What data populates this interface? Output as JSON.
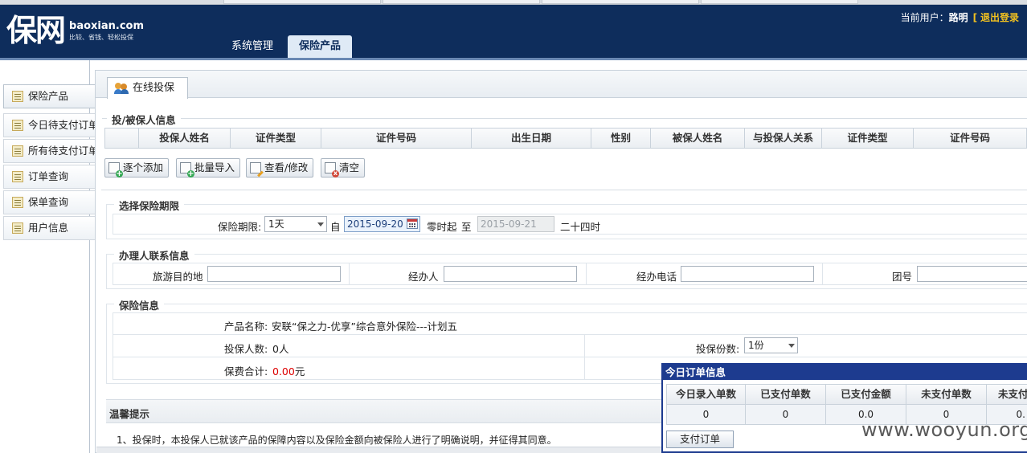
{
  "brand": {
    "mark": "保网",
    "domain": "baoxian.com",
    "slogan": "比较、省钱、轻松投保"
  },
  "userbar": {
    "label": "当前用户：",
    "username": "路明",
    "bracket": "[",
    "logout": "退出登录"
  },
  "nav": {
    "tabs": [
      {
        "label": "系统管理"
      },
      {
        "label": "保险产品"
      }
    ],
    "active": "保险产品"
  },
  "sidebar": {
    "items": [
      {
        "label": "保险产品",
        "icon": "document-icon"
      },
      {
        "label": "今日待支付订单",
        "icon": "document-icon"
      },
      {
        "label": "所有待支付订单",
        "icon": "document-icon"
      },
      {
        "label": "订单查询",
        "icon": "document-icon"
      },
      {
        "label": "保单查询",
        "icon": "document-icon"
      },
      {
        "label": "用户信息",
        "icon": "document-icon"
      }
    ]
  },
  "main": {
    "tab_label": "在线投保",
    "insured_section": {
      "legend": "投/被保人信息",
      "columns": [
        "投保人姓名",
        "证件类型",
        "证件号码",
        "出生日期",
        "性别",
        "被保人姓名",
        "与投保人关系",
        "证件类型",
        "证件号码"
      ],
      "buttons": [
        "逐个添加",
        "批量导入",
        "查看/修改",
        "清空"
      ]
    },
    "period_section": {
      "legend": "选择保险期限",
      "period_label": "保险期限:",
      "period_value": "1天",
      "from_label": "自",
      "start_date": "2015-09-20",
      "start_suffix": "零时起",
      "to_label": "至",
      "end_date": "2015-09-21",
      "end_suffix": "二十四时"
    },
    "contact_section": {
      "legend": "办理人联系信息",
      "fields": [
        {
          "label": "旅游目的地",
          "value": ""
        },
        {
          "label": "经办人",
          "value": ""
        },
        {
          "label": "经办电话",
          "value": ""
        },
        {
          "label": "团号",
          "value": ""
        }
      ]
    },
    "insurance_section": {
      "legend": "保险信息",
      "product_label": "产品名称:",
      "product_name": "安联“保之力-优享”综合意外保险---计划五",
      "count_label": "投保人数:",
      "count_value": "0人",
      "premium_label": "保费合计:",
      "premium_value": "0.00",
      "premium_unit": "元",
      "copies_label": "投保份数:",
      "copies_value": "1份"
    },
    "tips": {
      "title": "温馨提示",
      "line1": "1、投保时，本投保人已就该产品的保障内容以及保险金额向被保险人进行了明确说明，并征得其同意。"
    }
  },
  "order_panel": {
    "title": "今日订单信息",
    "columns": [
      "今日录入单数",
      "已支付单数",
      "已支付金额",
      "未支付单数",
      "未支付"
    ],
    "row": [
      "0",
      "0",
      "0.0",
      "0",
      "0."
    ],
    "pay_button": "支付订单"
  },
  "watermark": "www.wooyun.org",
  "colors": {
    "header_bg": "#0e2d5c",
    "accent": "#f0c020",
    "premium": "#dd0000",
    "order_title_bg": "#1d3b8f"
  }
}
